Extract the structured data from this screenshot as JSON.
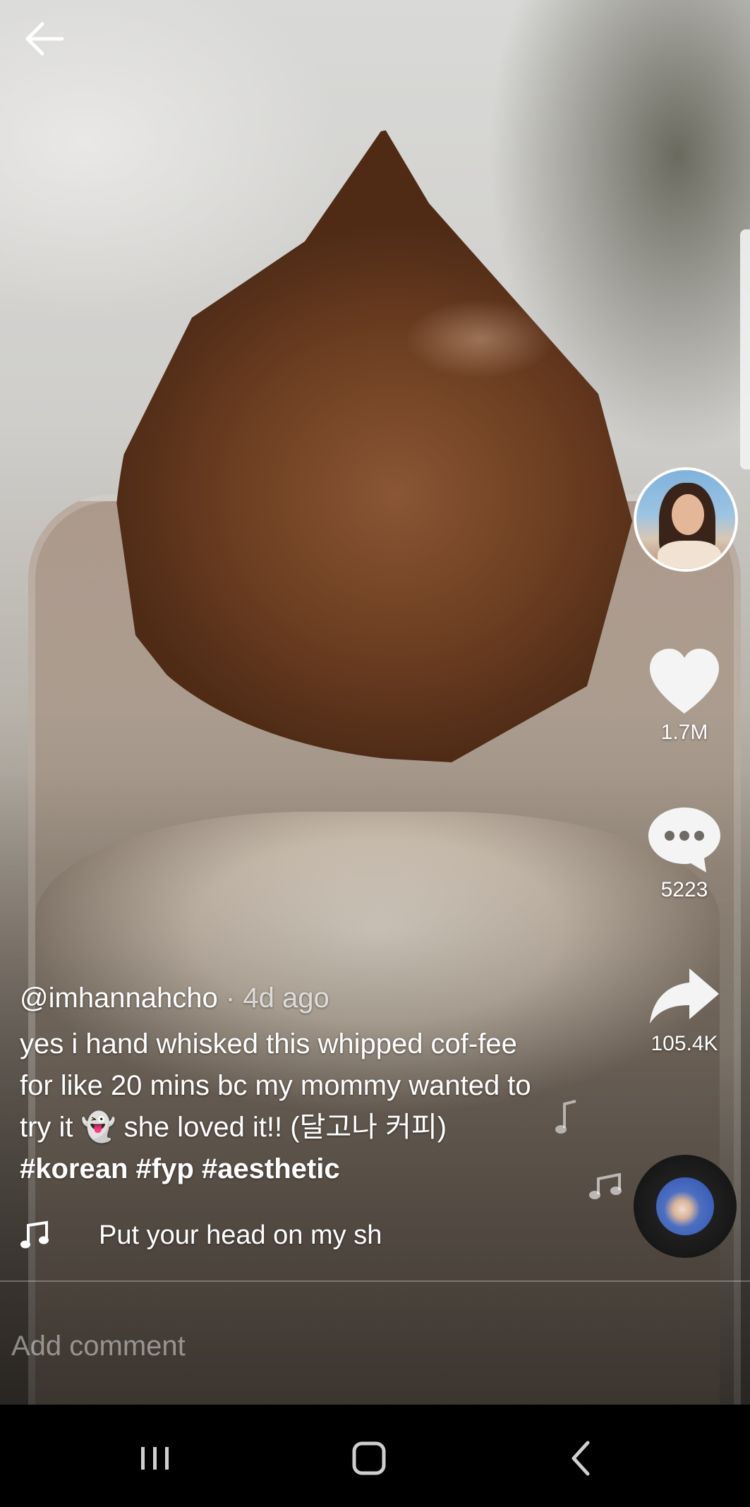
{
  "video": {
    "author": "@imhannahcho",
    "separator": "·",
    "time_ago": "4d ago",
    "caption_text": "yes i hand whisked this whipped cof-fee for like 20 mins bc my mommy wanted to try it 👻 she loved it!! (달고나 커피)",
    "hashtags": [
      "#korean",
      "#fyp",
      "#aesthetic"
    ],
    "song": "Put your head on my sh"
  },
  "actions": {
    "likes": "1.7M",
    "comments": "5223",
    "shares": "105.4K"
  },
  "comment_box": {
    "placeholder": "Add comment"
  },
  "icons": {
    "back": "arrow-left-icon",
    "like": "heart-icon",
    "comment": "speech-bubble-icon",
    "share": "share-arrow-icon",
    "music": "music-note-icon",
    "nav_recents": "recents-icon",
    "nav_home": "home-icon",
    "nav_back": "chevron-left-icon"
  },
  "colors": {
    "text": "#ffffff",
    "nav_bar": "#000000"
  }
}
